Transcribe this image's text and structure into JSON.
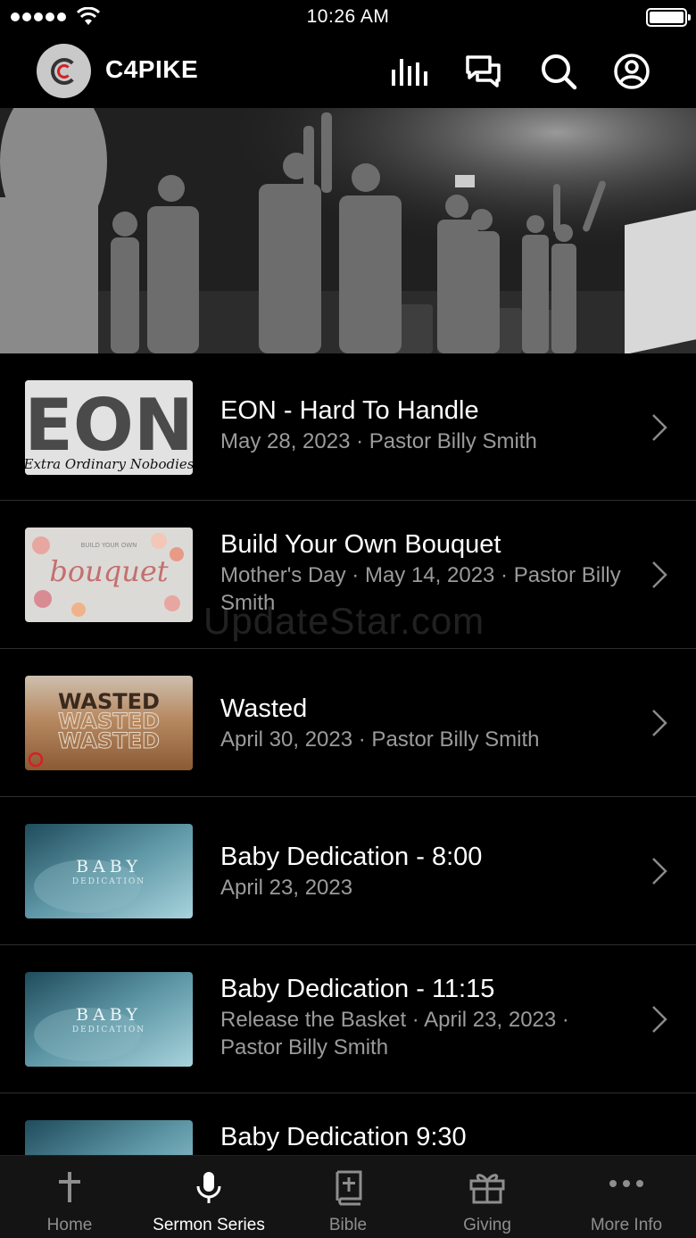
{
  "status_bar": {
    "time": "10:26 AM"
  },
  "header": {
    "app_name": "C4PIKE"
  },
  "sermons": [
    {
      "title": "EON - Hard To Handle",
      "subtitle": "May 28, 2023 · Pastor Billy Smith",
      "thumb_text": "EON",
      "thumb_caption": "Extra Ordinary Nobodies"
    },
    {
      "title": "Build Your Own Bouquet",
      "subtitle": "Mother's Day · May 14, 2023 · Pastor Billy Smith",
      "thumb_text": "bouquet",
      "thumb_caption": "BUILD YOUR OWN"
    },
    {
      "title": "Wasted",
      "subtitle": "April 30, 2023 · Pastor Billy Smith",
      "thumb_text": "WASTED"
    },
    {
      "title": "Baby Dedication - 8:00",
      "subtitle": "April 23, 2023",
      "thumb_text": "BABY",
      "thumb_caption": "DEDICATION"
    },
    {
      "title": "Baby Dedication - 11:15",
      "subtitle": "Release the Basket · April 23, 2023 · Pastor Billy Smith",
      "thumb_text": "BABY",
      "thumb_caption": "DEDICATION"
    },
    {
      "title": "Baby Dedication 9:30",
      "subtitle": ""
    }
  ],
  "watermark": "UpdateStar.com",
  "tabs": [
    {
      "label": "Home",
      "icon": "cross-icon"
    },
    {
      "label": "Sermon Series",
      "icon": "microphone-icon",
      "active": true
    },
    {
      "label": "Bible",
      "icon": "bible-icon"
    },
    {
      "label": "Giving",
      "icon": "gift-icon"
    },
    {
      "label": "More Info",
      "icon": "more-dots-icon"
    }
  ],
  "colors": {
    "background": "#000000",
    "tab_bar": "#141414",
    "subtitle": "#9b9b9b",
    "tab_inactive": "#8e8e8e",
    "logo_red": "#d32027"
  }
}
